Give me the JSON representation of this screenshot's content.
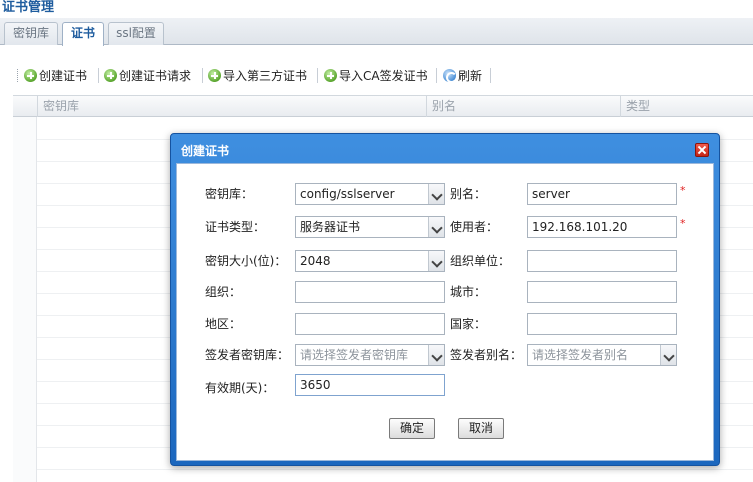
{
  "page": {
    "title": "证书管理"
  },
  "tabs": [
    {
      "label": "密钥库"
    },
    {
      "label": "证书"
    },
    {
      "label": "ssl配置"
    }
  ],
  "toolbar": {
    "create_cert": "创建证书",
    "create_cert_request": "创建证书请求",
    "import_third_party": "导入第三方证书",
    "import_ca_signed": "导入CA签发证书",
    "refresh": "刷新"
  },
  "grid": {
    "columns": [
      "密钥库",
      "别名",
      "类型"
    ]
  },
  "dialog": {
    "title": "创建证书",
    "fields": {
      "keystore": {
        "label": "密钥库：",
        "value": "config/sslserver"
      },
      "alias": {
        "label": "别名：",
        "value": "server"
      },
      "cert_type": {
        "label": "证书类型：",
        "value": "服务器证书"
      },
      "user": {
        "label": "使用者：",
        "value": "192.168.101.20"
      },
      "key_size": {
        "label": "密钥大小(位)：",
        "value": "2048"
      },
      "org_unit": {
        "label": "组织单位：",
        "value": ""
      },
      "org": {
        "label": "组织：",
        "value": ""
      },
      "city": {
        "label": "城市：",
        "value": ""
      },
      "region": {
        "label": "地区：",
        "value": ""
      },
      "country": {
        "label": "国家：",
        "value": ""
      },
      "issuer_keystore": {
        "label": "签发者密钥库：",
        "placeholder": "请选择签发者密钥库"
      },
      "issuer_alias": {
        "label": "签发者别名：",
        "placeholder": "请选择签发者别名"
      },
      "validity": {
        "label": "有效期(天)：",
        "value": "3650"
      }
    },
    "required_mark": "*",
    "ok_label": "确定",
    "cancel_label": "取消"
  },
  "colors": {
    "title_blue": "#1e5c9e",
    "dialog_header": "#1c67be",
    "required": "#e02020",
    "add_icon": "#5aa62e",
    "refresh_icon": "#4a8fd6"
  },
  "icons": [
    "add-icon",
    "refresh-icon",
    "close-icon",
    "chevron-down-icon"
  ]
}
